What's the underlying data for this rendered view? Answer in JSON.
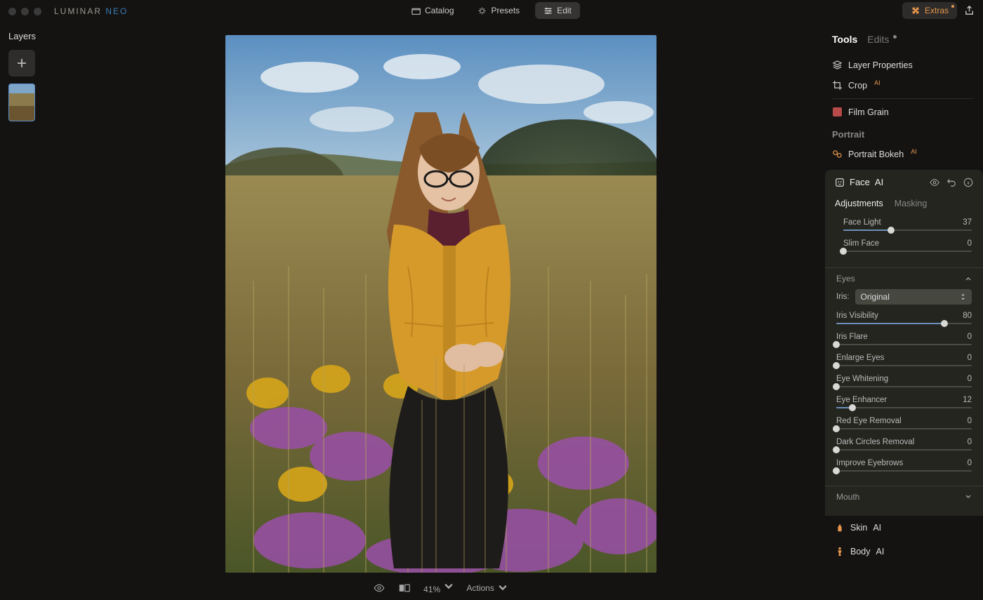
{
  "app": {
    "logo_a": "LUMINAR ",
    "logo_b": "NEO"
  },
  "tabs": {
    "catalog": "Catalog",
    "presets": "Presets",
    "edit": "Edit"
  },
  "extras": "Extras",
  "layers": {
    "title": "Layers"
  },
  "bottom": {
    "zoom": "41% ",
    "actions": "Actions"
  },
  "panel": {
    "tabs": {
      "tools": "Tools",
      "edits": "Edits"
    },
    "layer_properties": "Layer Properties",
    "crop": "Crop",
    "film_grain": "Film Grain",
    "portrait": "Portrait",
    "portrait_bokeh": "Portrait Bokeh",
    "skin": "Skin",
    "body": "Body"
  },
  "face": {
    "title": "Face",
    "subtabs": {
      "adjustments": "Adjustments",
      "masking": "Masking"
    },
    "sliders": {
      "face_light": {
        "label": "Face Light",
        "value": 37
      },
      "slim_face": {
        "label": "Slim Face",
        "value": 0
      }
    },
    "eyes": {
      "title": "Eyes",
      "iris_label": "Iris:",
      "iris_value": "Original",
      "sliders": {
        "iris_visibility": {
          "label": "Iris Visibility",
          "value": 80
        },
        "iris_flare": {
          "label": "Iris Flare",
          "value": 0
        },
        "enlarge_eyes": {
          "label": "Enlarge Eyes",
          "value": 0
        },
        "eye_whitening": {
          "label": "Eye Whitening",
          "value": 0
        },
        "eye_enhancer": {
          "label": "Eye Enhancer",
          "value": 12
        },
        "red_eye": {
          "label": "Red Eye Removal",
          "value": 0
        },
        "dark_circles": {
          "label": "Dark Circles Removal",
          "value": 0
        },
        "improve_eyebrows": {
          "label": "Improve Eyebrows",
          "value": 0
        }
      }
    },
    "mouth": {
      "title": "Mouth"
    }
  }
}
